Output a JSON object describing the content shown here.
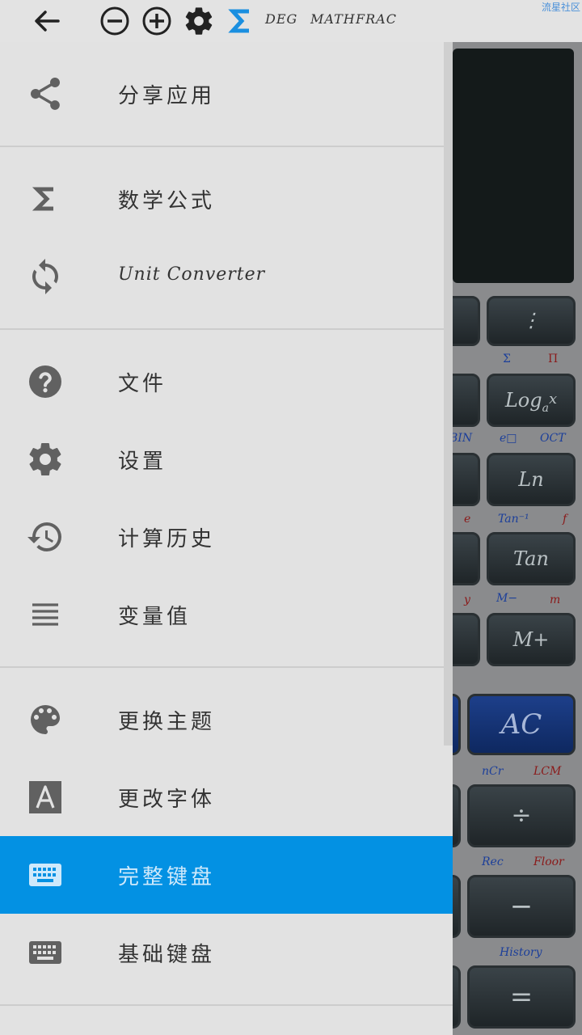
{
  "toolbar": {
    "mode": {
      "deg": "DEG",
      "math": "MATH",
      "frac": "FRAC"
    },
    "watermark": "流星社区"
  },
  "menu": {
    "share": "分享应用",
    "formulas": "数学公式",
    "unit_converter": "Unit Converter",
    "files": "文件",
    "settings": "设置",
    "history": "计算历史",
    "variables": "变量值",
    "theme": "更换主题",
    "font": "更改字体",
    "full_keyboard": "完整键盘",
    "basic_keyboard": "基础键盘"
  },
  "calculator": {
    "keys": {
      "more": "⋮",
      "log": "Log",
      "log_sub": "a",
      "log_x": "x",
      "ln": "Ln",
      "tan": "Tan",
      "mplus": "M+",
      "ac": "AC",
      "divide": "÷",
      "minus": "−",
      "equals": "="
    },
    "labels": {
      "sigma": "Σ",
      "pi": "Π",
      "bin": "BIN",
      "box": "e□",
      "oct": "OCT",
      "e": "e",
      "tan_inv": "Tan⁻¹",
      "f": "f",
      "y": "y",
      "mminus": "M−",
      "m": "m",
      "ncr": "nCr",
      "lcm": "LCM",
      "rec": "Rec",
      "floor": "Floor",
      "history": "History"
    }
  },
  "colors": {
    "accent": "#0391e3",
    "toolbar_sigma": "#1a8fe0"
  }
}
